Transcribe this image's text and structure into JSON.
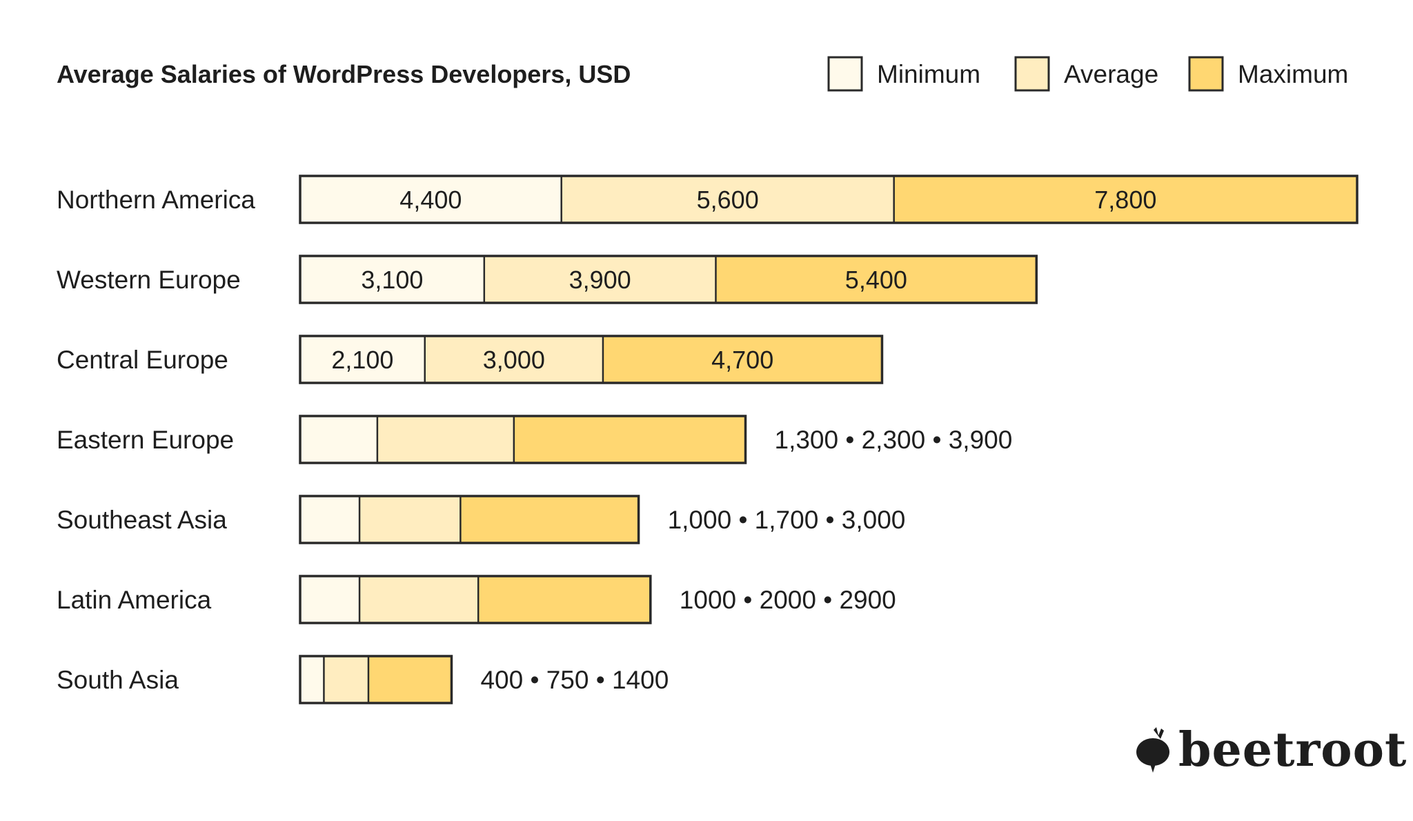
{
  "chart_data": {
    "type": "bar",
    "orientation": "horizontal",
    "stacked": true,
    "title": "Average Salaries of WordPress Developers, USD",
    "xlabel": "",
    "ylabel": "",
    "grid": false,
    "legend_position": "top-right",
    "categories": [
      "Northern America",
      "Western Europe",
      "Central Europe",
      "Eastern Europe",
      "Southeast Asia",
      "Latin America",
      "South Asia"
    ],
    "series": [
      {
        "name": "Minimum",
        "color": "#FFFAEB",
        "values": [
          4400,
          3100,
          2100,
          1300,
          1000,
          1000,
          400
        ]
      },
      {
        "name": "Average",
        "color": "#FFEDC0",
        "values": [
          5600,
          3900,
          3000,
          2300,
          1700,
          2000,
          750
        ]
      },
      {
        "name": "Maximum",
        "color": "#FFD772",
        "values": [
          7800,
          5400,
          4700,
          3900,
          3000,
          2900,
          1400
        ]
      }
    ],
    "inside_labels": [
      [
        "4,400",
        "5,600",
        "7,800"
      ],
      [
        "3,100",
        "3,900",
        "5,400"
      ],
      [
        "2,100",
        "3,000",
        "4,700"
      ],
      null,
      null,
      null,
      null
    ],
    "outside_labels": [
      null,
      null,
      null,
      "1,300 • 2,300 • 3,900",
      "1,000 • 1,700 • 3,000",
      "1000 • 2000 • 2900",
      "400 • 750 • 1400"
    ]
  },
  "brand": {
    "name": "beetroot",
    "icon": "beetroot-icon"
  },
  "colors": {
    "text": "#1e1e1e",
    "border": "#2a2a2a"
  }
}
